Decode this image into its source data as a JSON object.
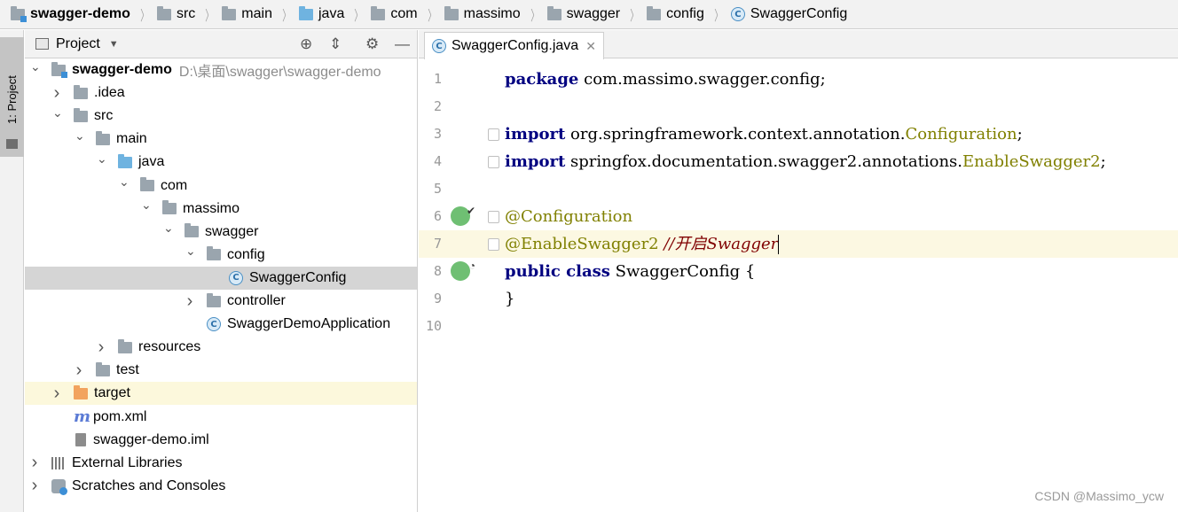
{
  "breadcrumb": [
    {
      "label": "swagger-demo",
      "icon": "module-folder-icon"
    },
    {
      "label": "src",
      "icon": "folder-icon"
    },
    {
      "label": "main",
      "icon": "folder-icon"
    },
    {
      "label": "java",
      "icon": "source-folder-icon"
    },
    {
      "label": "com",
      "icon": "package-icon"
    },
    {
      "label": "massimo",
      "icon": "package-icon"
    },
    {
      "label": "swagger",
      "icon": "package-icon"
    },
    {
      "label": "config",
      "icon": "package-icon"
    },
    {
      "label": "SwaggerConfig",
      "icon": "class-icon"
    }
  ],
  "left_strip": {
    "project_tab_label": "1: Project"
  },
  "project_panel": {
    "title": "Project",
    "tree": [
      {
        "label": "swagger-demo",
        "path": "D:\\桌面\\swagger\\swagger-demo",
        "depth": 0,
        "arrow": "down",
        "icon": "module",
        "bold": true
      },
      {
        "label": ".idea",
        "depth": 1,
        "arrow": "right",
        "icon": "folder"
      },
      {
        "label": "src",
        "depth": 1,
        "arrow": "down",
        "icon": "folder"
      },
      {
        "label": "main",
        "depth": 2,
        "arrow": "down",
        "icon": "folder"
      },
      {
        "label": "java",
        "depth": 3,
        "arrow": "down",
        "icon": "blue"
      },
      {
        "label": "com",
        "depth": 4,
        "arrow": "down",
        "icon": "folder"
      },
      {
        "label": "massimo",
        "depth": 5,
        "arrow": "down",
        "icon": "folder"
      },
      {
        "label": "swagger",
        "depth": 6,
        "arrow": "down",
        "icon": "folder"
      },
      {
        "label": "config",
        "depth": 7,
        "arrow": "down",
        "icon": "folder"
      },
      {
        "label": "SwaggerConfig",
        "depth": 8,
        "arrow": "none",
        "icon": "class",
        "selected": true
      },
      {
        "label": "controller",
        "depth": 7,
        "arrow": "right",
        "icon": "folder"
      },
      {
        "label": "SwaggerDemoApplication",
        "depth": 7,
        "arrow": "none",
        "icon": "class"
      },
      {
        "label": "resources",
        "depth": 3,
        "arrow": "right",
        "icon": "folder"
      },
      {
        "label": "test",
        "depth": 2,
        "arrow": "right",
        "icon": "folder"
      },
      {
        "label": "target",
        "depth": 1,
        "arrow": "right",
        "icon": "orange",
        "highlight": true
      },
      {
        "label": "pom.xml",
        "depth": 1,
        "arrow": "none",
        "icon": "maven"
      },
      {
        "label": "swagger-demo.iml",
        "depth": 1,
        "arrow": "none",
        "icon": "iml"
      },
      {
        "label": "External Libraries",
        "depth": 0,
        "arrow": "right",
        "icon": "libraries"
      },
      {
        "label": "Scratches and Consoles",
        "depth": 0,
        "arrow": "right",
        "icon": "scratches"
      }
    ]
  },
  "editor": {
    "tab_label": "SwaggerConfig.java",
    "current_line": 7,
    "lines": [
      {
        "num": "1",
        "tokens": [
          [
            "kw",
            "package"
          ],
          [
            "",
            " com.massimo.swagger.config;"
          ]
        ]
      },
      {
        "num": "2",
        "tokens": []
      },
      {
        "num": "3",
        "fold": true,
        "tokens": [
          [
            "kw",
            "import"
          ],
          [
            "",
            " org.springframework.context.annotation."
          ],
          [
            "cls",
            "Configuration"
          ],
          [
            "",
            ";"
          ]
        ]
      },
      {
        "num": "4",
        "fold": true,
        "tokens": [
          [
            "kw",
            "import"
          ],
          [
            "",
            " springfox.documentation.swagger2.annotations."
          ],
          [
            "cls",
            "EnableSwagger2"
          ],
          [
            "",
            ";"
          ]
        ]
      },
      {
        "num": "5",
        "tokens": []
      },
      {
        "num": "6",
        "fold": true,
        "gutter_icon": "spring-bean-icon",
        "tokens": [
          [
            "ann",
            "@Configuration"
          ]
        ]
      },
      {
        "num": "7",
        "fold": true,
        "tokens": [
          [
            "ann",
            "@EnableSwagger2"
          ],
          [
            "",
            " "
          ],
          [
            "cmt",
            "//开启Swagger"
          ]
        ],
        "caret": true
      },
      {
        "num": "8",
        "gutter_icon": "spring-config-icon",
        "tokens": [
          [
            "kw",
            "public class"
          ],
          [
            "",
            " SwaggerConfig {"
          ]
        ]
      },
      {
        "num": "9",
        "tokens": [
          [
            "",
            "}"
          ]
        ]
      },
      {
        "num": "10",
        "tokens": []
      }
    ]
  },
  "watermark": "CSDN @Massimo_ycw"
}
